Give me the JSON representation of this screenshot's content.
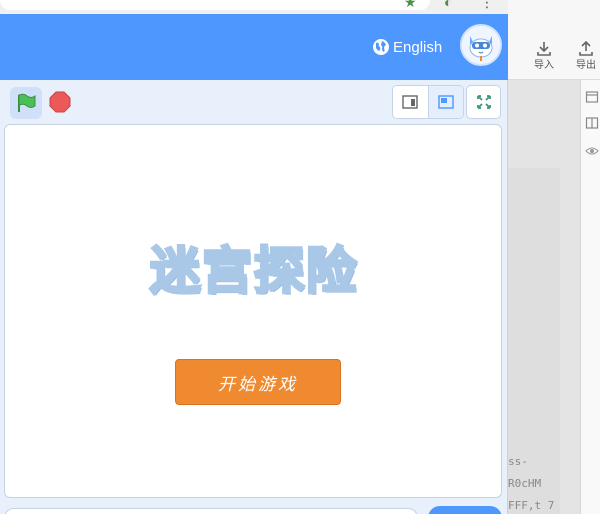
{
  "background_app": {
    "toolbar": {
      "import_label": "导入",
      "export_label": "导出"
    },
    "code_lines": [
      "ss-",
      "R0cHM",
      "FFF,t 7"
    ]
  },
  "header": {
    "language_label": "English",
    "icons": {
      "language": "globe-icon",
      "avatar": "robot-cat-avatar"
    }
  },
  "toolbar": {
    "icons": {
      "run": "green-flag-icon",
      "stop": "stop-sign-icon",
      "small_stage": "small-stage-icon",
      "large_stage": "large-stage-icon",
      "fullscreen": "fullscreen-icon"
    }
  },
  "stage": {
    "title": "迷宫探险",
    "start_button_label": "开始游戏"
  },
  "colors": {
    "header": "#4d97ff",
    "popup_bg": "#e8f0fb",
    "title": "#a9c8e8",
    "start_button": "#f08a30",
    "flag": "#4cbf56",
    "stop": "#ec5959"
  }
}
